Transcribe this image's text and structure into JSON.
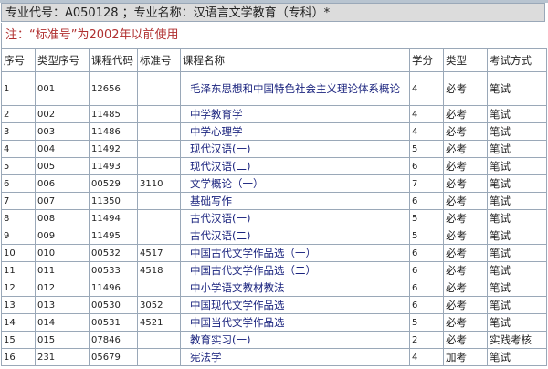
{
  "title": "专业代号：A050128 ；专业名称：汉语言文学教育（专科）*",
  "note": "注：“标准号”为2002年以前使用",
  "columns": [
    "序号",
    "类型序号",
    "课程代码",
    "标准号",
    "课程名称",
    "学分",
    "类型",
    "考试方式"
  ],
  "rows": [
    [
      "1",
      "001",
      "12656",
      "",
      "毛泽东思想和中国特色社会主义理论体系概论",
      "4",
      "必考",
      "笔试"
    ],
    [
      "2",
      "002",
      "11485",
      "",
      "中学教育学",
      "4",
      "必考",
      "笔试"
    ],
    [
      "3",
      "003",
      "11486",
      "",
      "中学心理学",
      "4",
      "必考",
      "笔试"
    ],
    [
      "4",
      "004",
      "11492",
      "",
      "现代汉语(一)",
      "5",
      "必考",
      "笔试"
    ],
    [
      "5",
      "005",
      "11493",
      "",
      "现代汉语(二)",
      "6",
      "必考",
      "笔试"
    ],
    [
      "6",
      "006",
      "00529",
      "3110",
      "文学概论（一）",
      "7",
      "必考",
      "笔试"
    ],
    [
      "7",
      "007",
      "11350",
      "",
      "基础写作",
      "6",
      "必考",
      "笔试"
    ],
    [
      "8",
      "008",
      "11494",
      "",
      "古代汉语(一)",
      "5",
      "必考",
      "笔试"
    ],
    [
      "9",
      "009",
      "11495",
      "",
      "古代汉语(二)",
      "5",
      "必考",
      "笔试"
    ],
    [
      "10",
      "010",
      "00532",
      "4517",
      "中国古代文学作品选（一）",
      "6",
      "必考",
      "笔试"
    ],
    [
      "11",
      "011",
      "00533",
      "4518",
      "中国古代文学作品选（二）",
      "6",
      "必考",
      "笔试"
    ],
    [
      "12",
      "012",
      "11496",
      "",
      "中小学语文教材教法",
      "6",
      "必考",
      "笔试"
    ],
    [
      "13",
      "013",
      "00530",
      "3052",
      "中国现代文学作品选",
      "6",
      "必考",
      "笔试"
    ],
    [
      "14",
      "014",
      "00531",
      "4521",
      "中国当代文学作品选",
      "5",
      "必考",
      "笔试"
    ],
    [
      "15",
      "015",
      "07846",
      "",
      "教育实习(一)",
      "2",
      "必考",
      "实践考核"
    ],
    [
      "16",
      "231",
      "05679",
      "",
      "宪法学",
      "4",
      "加考",
      "笔试"
    ]
  ]
}
